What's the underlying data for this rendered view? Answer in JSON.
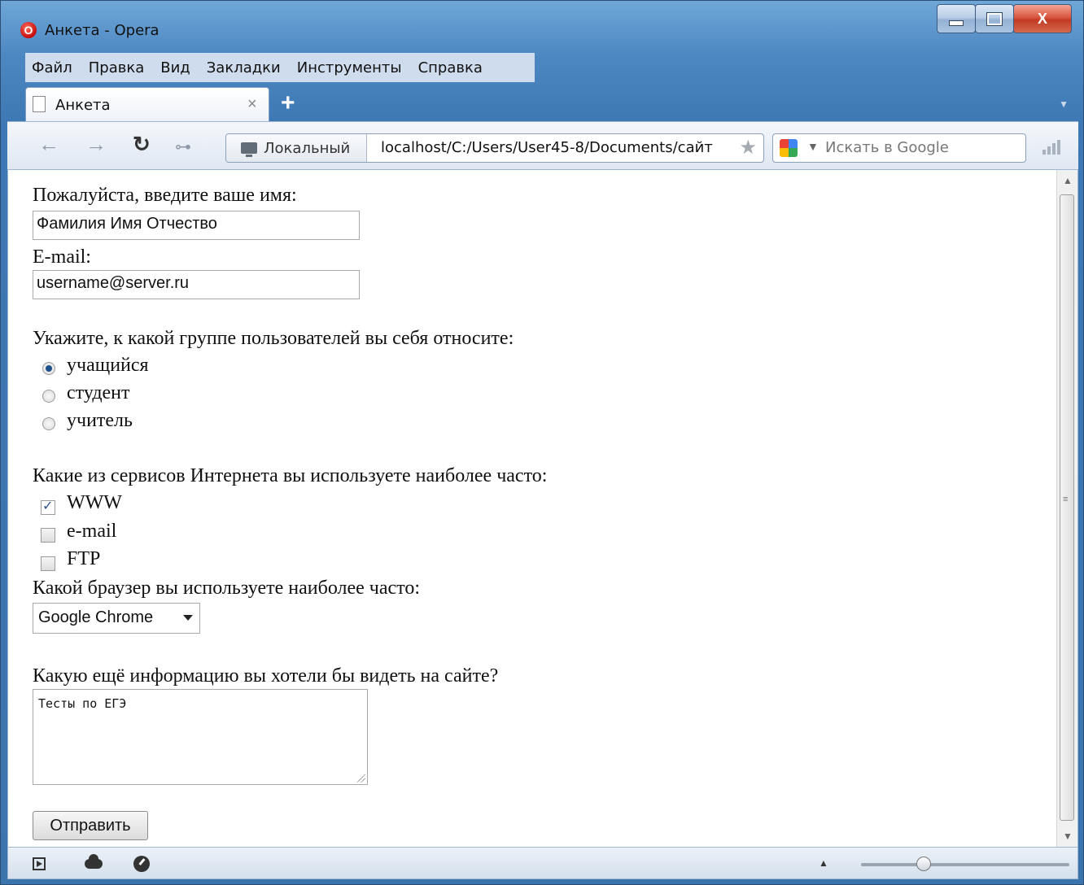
{
  "window": {
    "title": "Анкета - Opera",
    "icon": "opera-icon",
    "close_glyph": "X"
  },
  "menu": [
    "Файл",
    "Правка",
    "Вид",
    "Закладки",
    "Инструменты",
    "Справка"
  ],
  "tab": {
    "label": "Анкета",
    "close": "×",
    "add": "+"
  },
  "toolbar": {
    "site_badge": "Локальный",
    "url": "localhost/C:/Users/User45-8/Documents/сайт",
    "search_placeholder": "Искать в Google"
  },
  "form": {
    "name_label": "Пожалуйста, введите ваше имя:",
    "name_value": "Фамилия Имя Отчество",
    "email_label": "E-mail:",
    "email_value": "username@server.ru",
    "group_label": "Укажите, к какой группе пользователей вы себя относите:",
    "groups": [
      {
        "label": "учащийся",
        "checked": true
      },
      {
        "label": "студент",
        "checked": false
      },
      {
        "label": "учитель",
        "checked": false
      }
    ],
    "services_label": "Какие из сервисов Интернета вы используете наиболее часто:",
    "services": [
      {
        "label": "WWW",
        "checked": true
      },
      {
        "label": "e-mail",
        "checked": false
      },
      {
        "label": "FTP",
        "checked": false
      }
    ],
    "browser_label": "Какой браузер вы используете наиболее часто:",
    "browser_value": "Google Chrome",
    "info_label": "Какую ещё информацию вы хотели бы видеть на сайте?",
    "info_value": "Тесты по ЕГЭ",
    "submit_label": "Отправить"
  },
  "statusbar": {
    "zoom_fraction": 0.3
  }
}
